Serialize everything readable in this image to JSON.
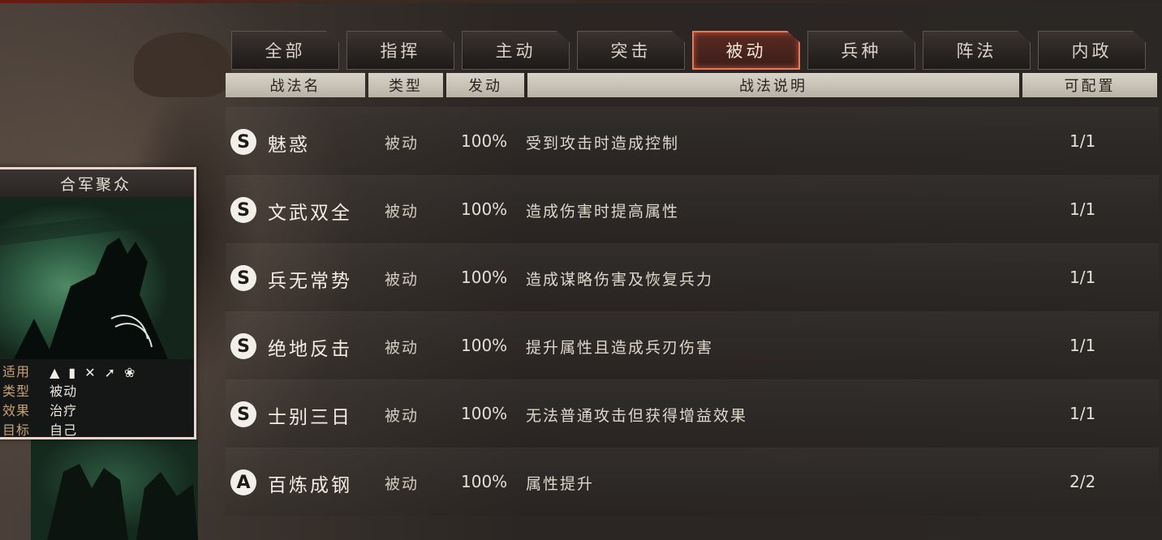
{
  "tabs": [
    {
      "label": "全部",
      "active": false
    },
    {
      "label": "指挥",
      "active": false
    },
    {
      "label": "主动",
      "active": false
    },
    {
      "label": "突击",
      "active": false
    },
    {
      "label": "被动",
      "active": true
    },
    {
      "label": "兵种",
      "active": false
    },
    {
      "label": "阵法",
      "active": false
    },
    {
      "label": "内政",
      "active": false
    }
  ],
  "header": {
    "name": "战法名",
    "type": "类型",
    "trigger": "发动",
    "desc": "战法说明",
    "config": "可配置"
  },
  "rows": [
    {
      "grade": "S",
      "name": "魅惑",
      "type": "被动",
      "rate": "100%",
      "desc": "受到攻击时造成控制",
      "config": "1/1"
    },
    {
      "grade": "S",
      "name": "文武双全",
      "type": "被动",
      "rate": "100%",
      "desc": "造成伤害时提高属性",
      "config": "1/1"
    },
    {
      "grade": "S",
      "name": "兵无常势",
      "type": "被动",
      "rate": "100%",
      "desc": "造成谋略伤害及恢复兵力",
      "config": "1/1"
    },
    {
      "grade": "S",
      "name": "绝地反击",
      "type": "被动",
      "rate": "100%",
      "desc": "提升属性且造成兵刃伤害",
      "config": "1/1"
    },
    {
      "grade": "S",
      "name": "士别三日",
      "type": "被动",
      "rate": "100%",
      "desc": "无法普通攻击但获得增益效果",
      "config": "1/1"
    },
    {
      "grade": "A",
      "name": "百炼成钢",
      "type": "被动",
      "rate": "100%",
      "desc": "属性提升",
      "config": "2/2"
    }
  ],
  "card": {
    "title": "合军聚众",
    "apply_label": "适用",
    "apply_icons": [
      "cavalry-icon",
      "shield-icon",
      "bow-icon",
      "spear-icon",
      "wheel-icon"
    ],
    "type_label": "类型",
    "type_value": "被动",
    "effect_label": "效果",
    "effect_value": "治疗",
    "target_label": "目标",
    "target_value": "自己"
  },
  "colors": {
    "active_tab_border": "#e07a5a",
    "header_bg": "#d8d3c8",
    "card_border": "#e8d6cc",
    "info_label": "#c8a272"
  }
}
